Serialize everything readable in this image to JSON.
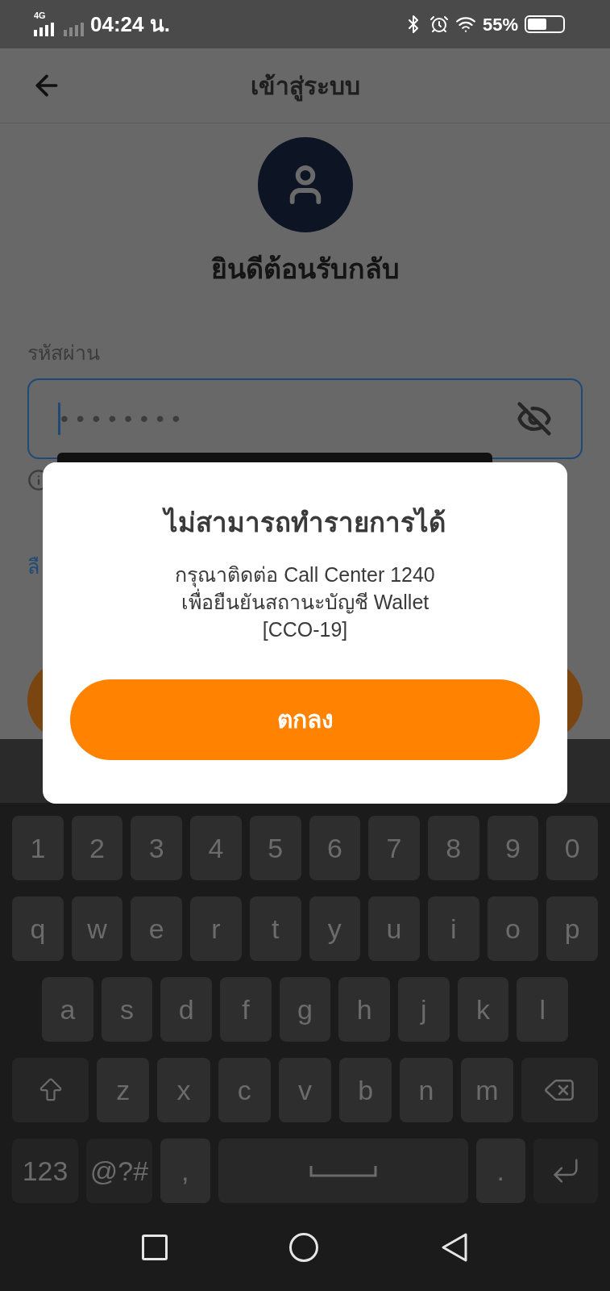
{
  "status_bar": {
    "network": "4G",
    "time": "04:24 น.",
    "battery": "55%"
  },
  "header": {
    "title": "เข้าสู่ระบบ"
  },
  "welcome": "ยินดีต้อนรับกลับ",
  "password": {
    "label": "รหัสผ่าน",
    "value": "••••••••",
    "masked": true
  },
  "forgot_link_partial": "ลื",
  "dialog": {
    "title": "ไม่สามารถทำรายการได้",
    "lines": [
      "กรุณาติดต่อ Call Center 1240",
      "เพื่อยืนยันสถานะบัญชี Wallet",
      "[CCO-19]"
    ],
    "button": "ตกลง"
  },
  "keyboard": {
    "rows": [
      [
        "1",
        "2",
        "3",
        "4",
        "5",
        "6",
        "7",
        "8",
        "9",
        "0"
      ],
      [
        "q",
        "w",
        "e",
        "r",
        "t",
        "y",
        "u",
        "i",
        "o",
        "p"
      ],
      [
        "a",
        "s",
        "d",
        "f",
        "g",
        "h",
        "j",
        "k",
        "l"
      ],
      [
        {
          "kind": "shift"
        },
        "z",
        "x",
        "c",
        "v",
        "b",
        "n",
        "m",
        {
          "kind": "backspace"
        }
      ],
      [
        {
          "kind": "text",
          "label": "123"
        },
        {
          "kind": "text",
          "label": "@?#"
        },
        ",",
        {
          "kind": "space"
        },
        ".",
        {
          "kind": "enter"
        }
      ]
    ]
  }
}
